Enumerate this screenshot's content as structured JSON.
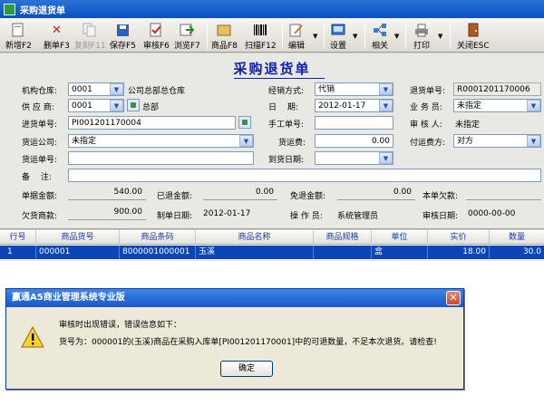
{
  "window": {
    "title": "采购退货单"
  },
  "toolbar": {
    "new": "新增F2",
    "delete": "删单F3",
    "copy": "复制F11",
    "save": "保存F5",
    "audit": "审核F6",
    "browse": "浏览F7",
    "product": "商品F8",
    "scan": "扫描F12",
    "edit": "编辑",
    "settings": "设置",
    "related": "相关",
    "print": "打印",
    "close": "关闭ESC"
  },
  "form": {
    "title": "采购退货单",
    "warehouse": {
      "label": "机构仓库:",
      "code": "0001",
      "name": "公司总部总仓库"
    },
    "supplier": {
      "label": "供 应 商:",
      "code": "0001",
      "name": "总部"
    },
    "purchase_no": {
      "label": "进货单号:",
      "value": "PI001201170004"
    },
    "freight_company": {
      "label": "货运公司:",
      "value": "未指定"
    },
    "freight_no": {
      "label": "货运单号:",
      "value": ""
    },
    "remark": {
      "label": "备　 注:",
      "value": ""
    },
    "sale_mode": {
      "label": "经销方式:",
      "value": "代销"
    },
    "date": {
      "label": "日　 期:",
      "value": "2012-01-17"
    },
    "manual_no": {
      "label": "手工单号:",
      "value": ""
    },
    "freight_fee": {
      "label": "货运费:",
      "value": "0.00"
    },
    "arrival_date": {
      "label": "到货日期:",
      "value": ""
    },
    "return_no": {
      "label": "退货单号:",
      "value": "R0001201170006"
    },
    "salesman": {
      "label": "业 务 员:",
      "value": "未指定"
    },
    "auditor": {
      "label": "审 核 人:",
      "value": "未指定"
    },
    "freight_payer": {
      "label": "付运费方:",
      "value": "对方"
    },
    "total_amount": {
      "label": "单据金额:",
      "value": "540.00"
    },
    "refunded": {
      "label": "已退金额:",
      "value": "0.00"
    },
    "exempt": {
      "label": "免退金额:",
      "value": "0.00"
    },
    "owed_this": {
      "label": "本单欠款:",
      "value": ""
    },
    "owed_goods": {
      "label": "欠货商款:",
      "value": "900.00"
    },
    "created_date": {
      "label": "制单日期:",
      "value": "2012-01-17"
    },
    "operator": {
      "label": "操 作 员:",
      "value": "系统管理员"
    },
    "audit_date": {
      "label": "审核日期:",
      "value": "0000-00-00"
    }
  },
  "grid": {
    "headers": [
      "行号",
      "商品货号",
      "商品条码",
      "商品名称",
      "商品规格",
      "单位",
      "实价",
      "数量"
    ],
    "row": {
      "no": "1",
      "code": "000001",
      "barcode": "8000001000001",
      "name": "玉溪",
      "spec": "",
      "unit": "盒",
      "price": "18.00",
      "qty": "30.0"
    }
  },
  "dialog": {
    "title": "赢通A5商业管理系统专业版",
    "line1": "审核时出现错误，错误信息如下：",
    "line2": "货号为：000001的(玉溪)商品在采购入库单[PI001201170001]中的可退数量，不足本次退货。请检查!",
    "ok": "确定"
  },
  "colors": {
    "title_blue": "#1020b0",
    "selected_row": "#0b45b8",
    "titlebar": "#0b4fc0"
  }
}
